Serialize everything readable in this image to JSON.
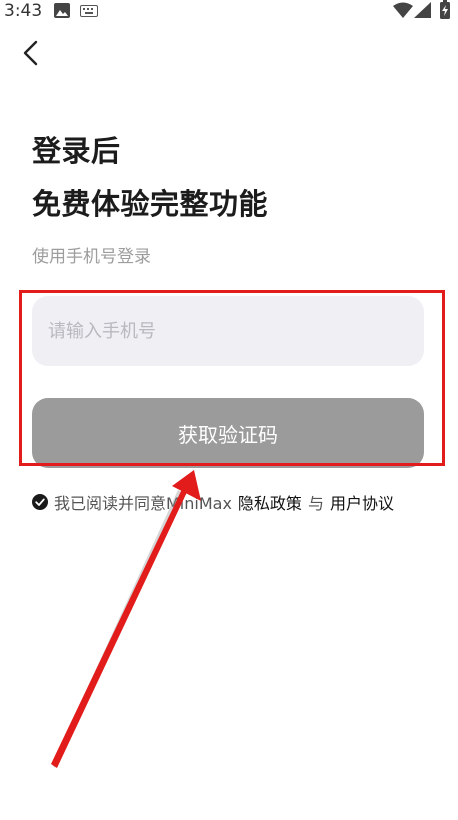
{
  "status_bar": {
    "time": "3:43",
    "left_icons": [
      "image-icon",
      "keyboard-icon"
    ],
    "right_icons": [
      "wifi-icon",
      "signal-icon",
      "battery-icon"
    ]
  },
  "header": {
    "back_icon": "chevron-left-icon"
  },
  "login": {
    "title_line1": "登录后",
    "title_line2": "免费体验完整功能",
    "subtitle": "使用手机号登录",
    "phone_placeholder": "请输入手机号",
    "phone_value": "",
    "code_button_label": "获取验证码"
  },
  "agreement": {
    "checked": true,
    "text": "我已阅读并同意MiniMax",
    "privacy_link": "隐私政策",
    "conjunction": "与",
    "terms_link": "用户协议"
  },
  "colors": {
    "annotation_red": "#e21b1b",
    "button_gray": "#9b9b9b",
    "input_bg": "#efeff4",
    "subtitle_gray": "#9d9d9d"
  }
}
